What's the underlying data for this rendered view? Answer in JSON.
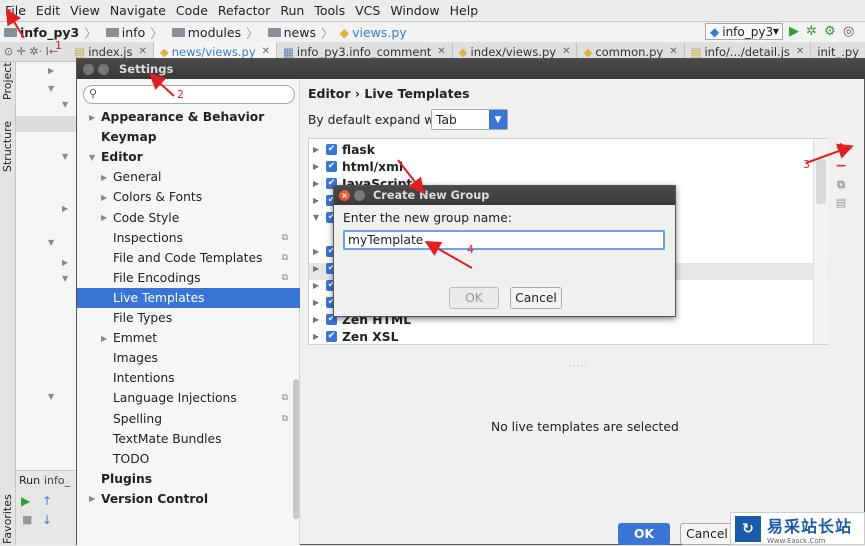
{
  "menubar": {
    "items": [
      "File",
      "Edit",
      "View",
      "Navigate",
      "Code",
      "Refactor",
      "Run",
      "Tools",
      "VCS",
      "Window",
      "Help"
    ]
  },
  "navbar": {
    "crumbs": [
      "info_py3",
      "info",
      "modules",
      "news",
      "views.py"
    ],
    "run_config": "info_py3"
  },
  "tabs": [
    "index.js",
    "news/views.py",
    "info_py3.info_comment",
    "index/views.py",
    "common.py",
    "info/.../detail.js",
    "init_.py"
  ],
  "toolwindows": {
    "project": "Project",
    "structure": "Structure",
    "favorites": "Favorites",
    "run": "Run",
    "run_file": "info_"
  },
  "settings": {
    "title": "Settings",
    "nav": [
      {
        "label": "Appearance & Behavior",
        "level": 0,
        "bold": true,
        "arrow": "▶"
      },
      {
        "label": "Keymap",
        "level": 0,
        "bold": true,
        "arrow": ""
      },
      {
        "label": "Editor",
        "level": 0,
        "bold": true,
        "arrow": "▼"
      },
      {
        "label": "General",
        "level": 1,
        "bold": false,
        "arrow": "▶"
      },
      {
        "label": "Colors & Fonts",
        "level": 1,
        "bold": false,
        "arrow": "▶"
      },
      {
        "label": "Code Style",
        "level": 1,
        "bold": false,
        "arrow": "▶"
      },
      {
        "label": "Inspections",
        "level": 1,
        "bold": false,
        "arrow": "",
        "cfg": true
      },
      {
        "label": "File and Code Templates",
        "level": 1,
        "bold": false,
        "arrow": "",
        "cfg": true
      },
      {
        "label": "File Encodings",
        "level": 1,
        "bold": false,
        "arrow": "",
        "cfg": true
      },
      {
        "label": "Live Templates",
        "level": 1,
        "bold": false,
        "arrow": "",
        "selected": true
      },
      {
        "label": "File Types",
        "level": 1,
        "bold": false,
        "arrow": ""
      },
      {
        "label": "Emmet",
        "level": 1,
        "bold": false,
        "arrow": "▶"
      },
      {
        "label": "Images",
        "level": 1,
        "bold": false,
        "arrow": ""
      },
      {
        "label": "Intentions",
        "level": 1,
        "bold": false,
        "arrow": ""
      },
      {
        "label": "Language Injections",
        "level": 1,
        "bold": false,
        "arrow": "",
        "cfg": true
      },
      {
        "label": "Spelling",
        "level": 1,
        "bold": false,
        "arrow": "",
        "cfg": true
      },
      {
        "label": "TextMate Bundles",
        "level": 1,
        "bold": false,
        "arrow": ""
      },
      {
        "label": "TODO",
        "level": 1,
        "bold": false,
        "arrow": ""
      },
      {
        "label": "Plugins",
        "level": 0,
        "bold": true,
        "arrow": ""
      },
      {
        "label": "Version Control",
        "level": 0,
        "bold": true,
        "arrow": "▶"
      }
    ],
    "breadcrumb": "Editor › Live Templates",
    "expand_label": "By default expand with",
    "expand_value": "Tab",
    "templates": [
      "flask",
      "html/xml",
      "JavaScript",
      "Zen HTML",
      "Zen XSL"
    ],
    "no_selection": "No live templates are selected",
    "ok": "OK",
    "cancel": "Cancel"
  },
  "dialog": {
    "title": "Create New Group",
    "label": "Enter the new group name:",
    "value": "myTemplate",
    "ok": "OK",
    "cancel": "Cancel"
  },
  "annotations": [
    "1",
    "2",
    "3",
    "4"
  ],
  "watermark": {
    "text": "易采站长站",
    "subtext": "Www.Easck.Com"
  },
  "colors": {
    "accent": "#3875d7",
    "annotation": "#e02020"
  }
}
